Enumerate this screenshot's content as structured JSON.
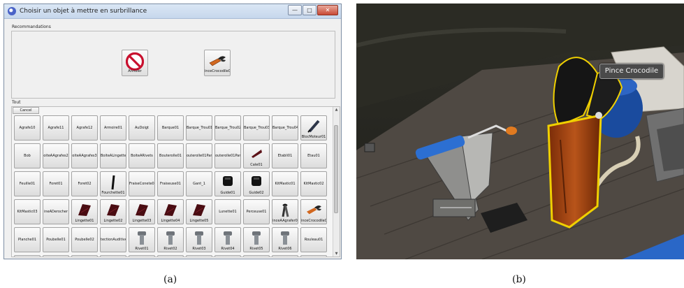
{
  "dialog": {
    "title": "Choisir un objet à mettre en surbrillance",
    "recommendations_label": "Recommandations",
    "recommendations": [
      {
        "label": "Annuler",
        "icon": "forbidden-icon"
      },
      {
        "label": "inceCrocodile0",
        "icon": "crocodile-clip-icon"
      }
    ],
    "all_label": "Tout",
    "cancel_label": "Cancel",
    "items": [
      {
        "label": "Agrafe10",
        "icon": ""
      },
      {
        "label": "Agrafe11",
        "icon": ""
      },
      {
        "label": "Agrafe12",
        "icon": ""
      },
      {
        "label": "Armoire01",
        "icon": ""
      },
      {
        "label": "AuDoigt",
        "icon": ""
      },
      {
        "label": "Barque01",
        "icon": ""
      },
      {
        "label": "Barque_Trou01",
        "icon": ""
      },
      {
        "label": "Barque_Trou02",
        "icon": ""
      },
      {
        "label": "Barque_Trou03",
        "icon": ""
      },
      {
        "label": "Barque_Trou04",
        "icon": ""
      },
      {
        "label": "BlocMoteur01",
        "icon": "pen-icon"
      },
      {
        "label": "Bob",
        "icon": ""
      },
      {
        "label": "oiteAAgrafes2",
        "icon": ""
      },
      {
        "label": "oiteAAgrafes3",
        "icon": ""
      },
      {
        "label": "BoiteALingettes",
        "icon": ""
      },
      {
        "label": "BoiteARivets",
        "icon": ""
      },
      {
        "label": "Bouterolle01",
        "icon": ""
      },
      {
        "label": "outerolle01Part",
        "icon": ""
      },
      {
        "label": "outerolle01Part",
        "icon": ""
      },
      {
        "label": "Cale01",
        "icon": "wedge-icon"
      },
      {
        "label": "Etabli01",
        "icon": ""
      },
      {
        "label": "Etau01",
        "icon": ""
      },
      {
        "label": "Feuille01",
        "icon": ""
      },
      {
        "label": "Foret01",
        "icon": ""
      },
      {
        "label": "Foret02",
        "icon": ""
      },
      {
        "label": "Fourchette01",
        "icon": "rod-icon"
      },
      {
        "label": "FraiseConete01",
        "icon": ""
      },
      {
        "label": "Fraiseuse01",
        "icon": ""
      },
      {
        "label": "Gant_1",
        "icon": ""
      },
      {
        "label": "Guide01",
        "icon": "guide-icon"
      },
      {
        "label": "Guide02",
        "icon": "guide-icon"
      },
      {
        "label": "KitMastic01",
        "icon": ""
      },
      {
        "label": "KitMastic02",
        "icon": ""
      },
      {
        "label": "KitMastic03",
        "icon": ""
      },
      {
        "label": "ineADerocher",
        "icon": ""
      },
      {
        "label": "Lingette01",
        "icon": "wipe-icon"
      },
      {
        "label": "Lingette02",
        "icon": "wipe-icon"
      },
      {
        "label": "Lingette03",
        "icon": "wipe-icon"
      },
      {
        "label": "Lingette04",
        "icon": "wipe-icon"
      },
      {
        "label": "Lingette05",
        "icon": "wipe-icon"
      },
      {
        "label": "Lunette01",
        "icon": ""
      },
      {
        "label": "Perceuse01",
        "icon": ""
      },
      {
        "label": "inceAAgrafer0",
        "icon": "staple-pliers-icon"
      },
      {
        "label": "inceCrocodile0",
        "icon": "crocodile-clip-icon"
      },
      {
        "label": "Planche01",
        "icon": ""
      },
      {
        "label": "Poubelle01",
        "icon": ""
      },
      {
        "label": "Poubelle02",
        "icon": ""
      },
      {
        "label": "tectionAuditive",
        "icon": ""
      },
      {
        "label": "Rivet01",
        "icon": "rivet-icon"
      },
      {
        "label": "Rivet02",
        "icon": "rivet-icon"
      },
      {
        "label": "Rivet03",
        "icon": "rivet-icon"
      },
      {
        "label": "Rivet04",
        "icon": "rivet-icon"
      },
      {
        "label": "Rivet05",
        "icon": "rivet-icon"
      },
      {
        "label": "Rivet06",
        "icon": "rivet-icon"
      },
      {
        "label": "Rouleau01",
        "icon": ""
      }
    ]
  },
  "scene": {
    "tooltip": "Pince Crocodile",
    "highlight_color": "#f0d000"
  },
  "captions": {
    "a": "(a)",
    "b": "(b)"
  }
}
